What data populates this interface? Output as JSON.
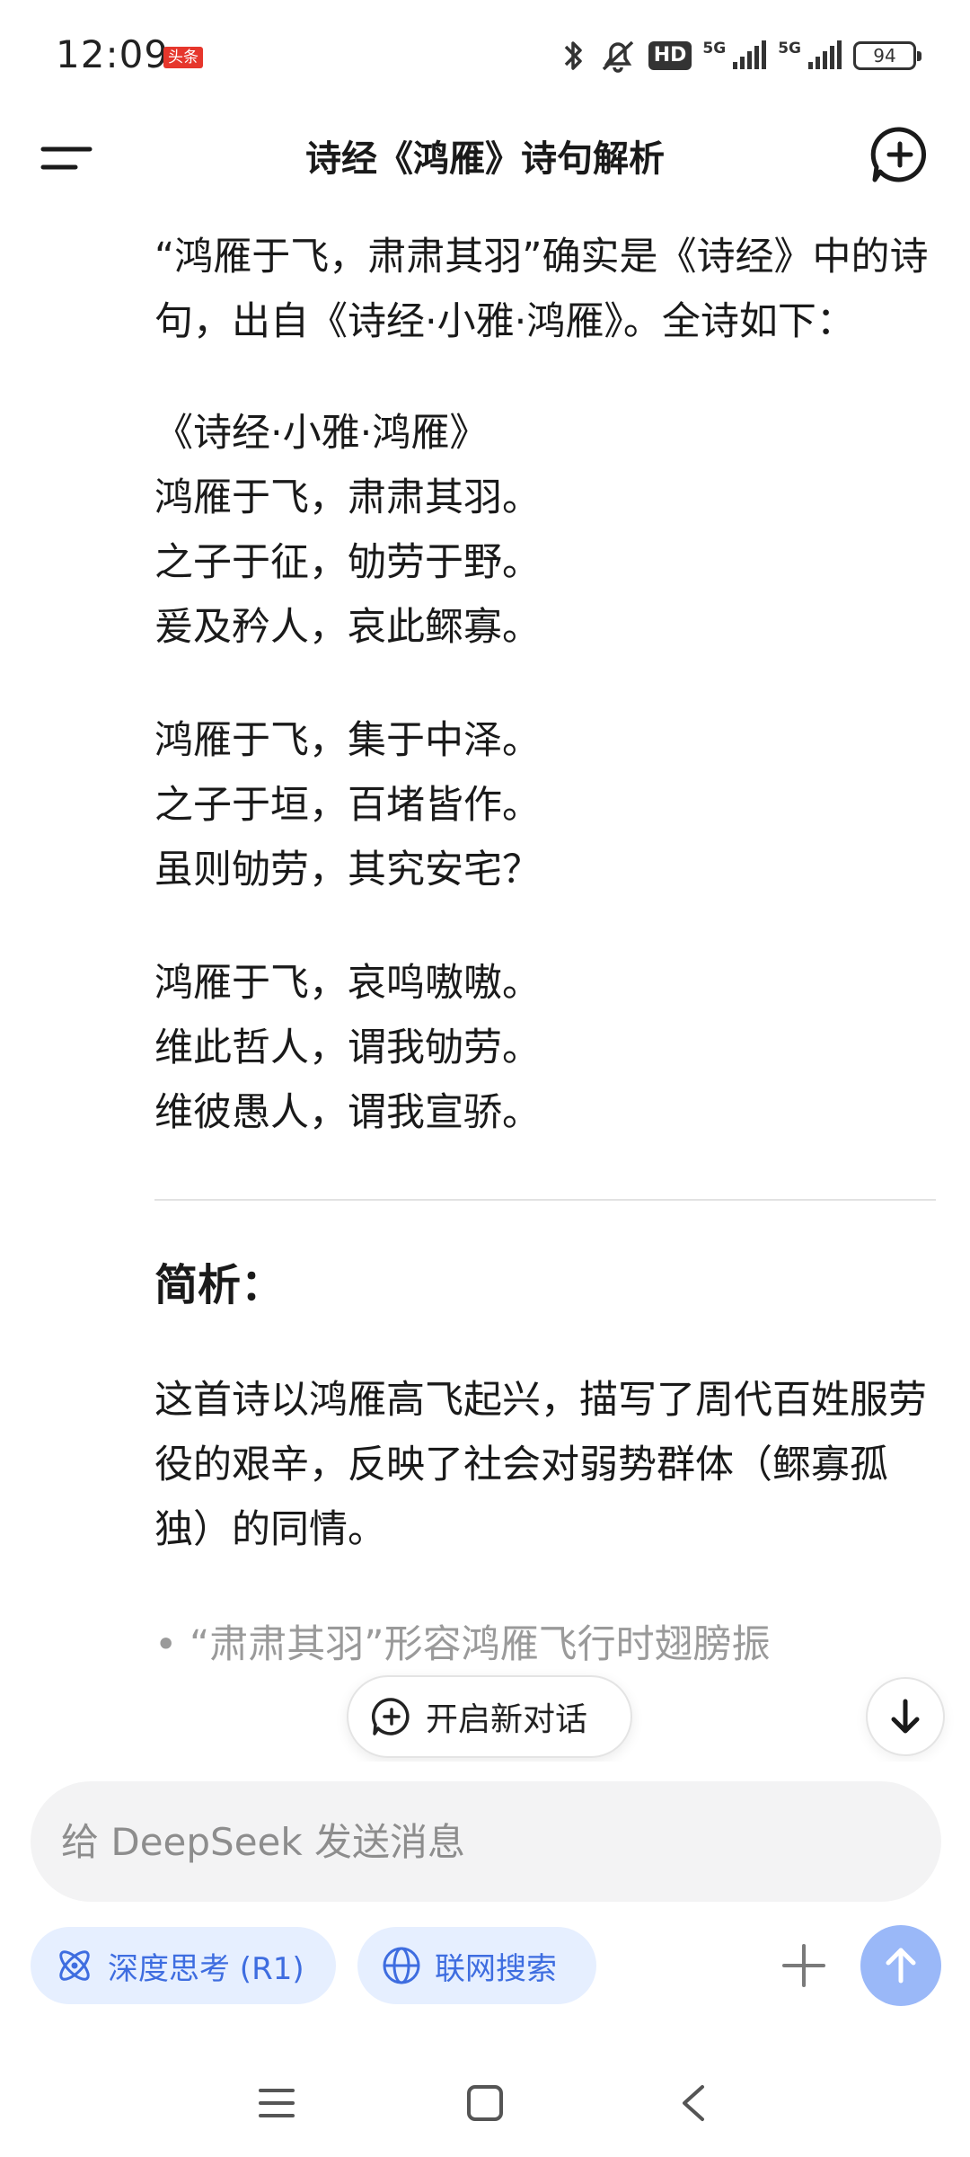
{
  "status_bar": {
    "time": "12:09",
    "badge": "头条",
    "hd_label": "HD",
    "net1": "5G",
    "net2": "5G",
    "battery": "94"
  },
  "header": {
    "title": "诗经《鸿雁》诗句解析"
  },
  "message": {
    "intro": "“鸿雁于飞，肃肃其羽”确实是《诗经》中的诗句，出自《诗经·小雅·鸿雁》。全诗如下：",
    "poem_title": "《诗经·小雅·鸿雁》",
    "stanzas": [
      [
        "鸿雁于飞，肃肃其羽。",
        "之子于征，劬劳于野。",
        "爰及矜人，哀此鳏寡。"
      ],
      [
        "鸿雁于飞，集于中泽。",
        "之子于垣，百堵皆作。",
        "虽则劬劳，其究安宅？"
      ],
      [
        "鸿雁于飞，哀鸣嗷嗷。",
        "维此哲人，谓我劬劳。",
        "维彼愚人，谓我宣骄。"
      ]
    ],
    "analysis_heading": "简析：",
    "analysis_body": "这首诗以鸿雁高飞起兴，描写了周代百姓服劳役的艰辛，反映了社会对弱势群体（鳏寡孤独）的同情。",
    "bullet_partial": "• “肃肃其羽”形容鸿雁飞行时翅膀振"
  },
  "floating": {
    "new_chat_label": "开启新对话"
  },
  "composer": {
    "placeholder": "给 DeepSeek 发送消息",
    "deep_think_label": "深度思考 (R1)",
    "web_search_label": "联网搜索",
    "accent_color": "#3e6de0",
    "send_color": "#9ab8f8"
  }
}
